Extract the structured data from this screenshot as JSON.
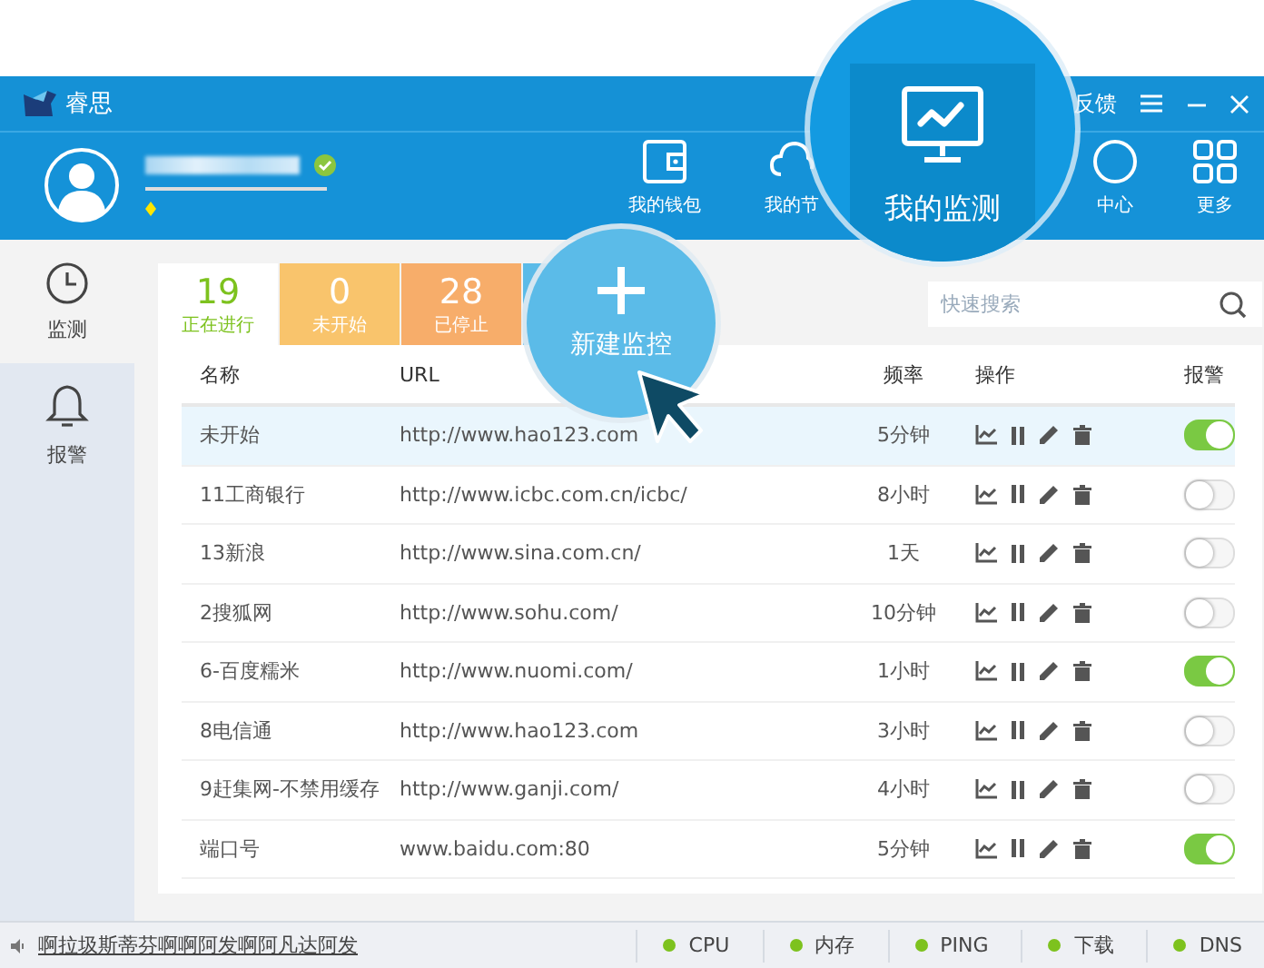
{
  "app": {
    "title": "睿思"
  },
  "window_controls": {
    "feedback": "反馈"
  },
  "user": {
    "verified": true
  },
  "nav": [
    {
      "label": "我的钱包"
    },
    {
      "label": "我的节"
    },
    {
      "label": "中心"
    },
    {
      "label": "更多"
    }
  ],
  "magnifier": {
    "label": "我的监测"
  },
  "sidebar": [
    {
      "label": "监测",
      "selected": true
    },
    {
      "label": "报警",
      "selected": false
    }
  ],
  "stats": [
    {
      "count": "19",
      "label": "正在进行",
      "selected": true,
      "color": "#7dc21e"
    },
    {
      "count": "0",
      "label": "未开始",
      "selected": false,
      "color": "#f9c46c"
    },
    {
      "count": "28",
      "label": "已停止",
      "selected": false,
      "color": "#f7ad6a"
    }
  ],
  "new_button": {
    "label": "新建监控"
  },
  "search": {
    "placeholder": "快速搜索"
  },
  "table": {
    "columns": [
      "名称",
      "URL",
      "频率",
      "操作",
      "报警"
    ],
    "rows": [
      {
        "name": "未开始",
        "url": "http://www.hao123.com",
        "frequency": "5分钟",
        "alarm": true,
        "selected": true
      },
      {
        "name": "11工商银行",
        "url": "http://www.icbc.com.cn/icbc/",
        "frequency": "8小时",
        "alarm": false,
        "selected": false
      },
      {
        "name": "13新浪",
        "url": "http://www.sina.com.cn/",
        "frequency": "1天",
        "alarm": false,
        "selected": false
      },
      {
        "name": "2搜狐网",
        "url": "http://www.sohu.com/",
        "frequency": "10分钟",
        "alarm": false,
        "selected": false
      },
      {
        "name": "6-百度糯米",
        "url": "http://www.nuomi.com/",
        "frequency": "1小时",
        "alarm": true,
        "selected": false
      },
      {
        "name": "8电信通",
        "url": "http://www.hao123.com",
        "frequency": "3小时",
        "alarm": false,
        "selected": false
      },
      {
        "name": "9赶集网-不禁用缓存",
        "url": "http://www.ganji.com/",
        "frequency": "4小时",
        "alarm": false,
        "selected": false
      },
      {
        "name": "端口号",
        "url": "www.baidu.com:80",
        "frequency": "5分钟",
        "alarm": true,
        "selected": false
      }
    ]
  },
  "status_bar": {
    "message": "啊拉圾斯蒂芬啊啊阿发啊阿凡达阿发",
    "indicators": [
      {
        "label": "CPU",
        "color": "#7dc21e"
      },
      {
        "label": "内存",
        "color": "#7dc21e"
      },
      {
        "label": "PING",
        "color": "#7dc21e"
      },
      {
        "label": "下载",
        "color": "#7dc21e"
      },
      {
        "label": "DNS",
        "color": "#7dc21e"
      }
    ]
  }
}
